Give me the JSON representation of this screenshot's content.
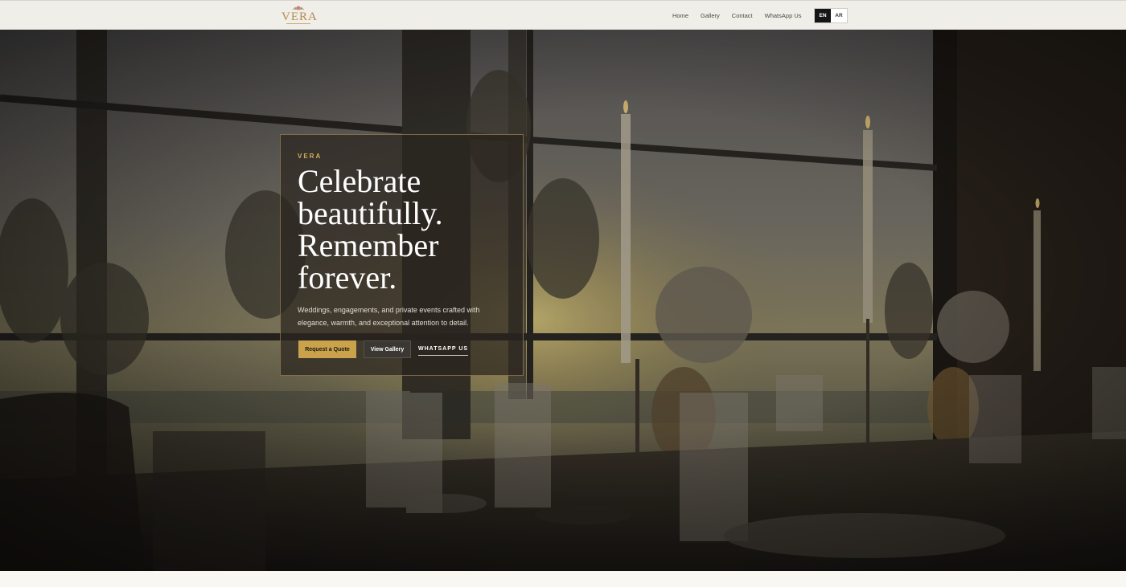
{
  "nav": {
    "logo_text": "VERA",
    "links": [
      "Home",
      "Gallery",
      "Contact",
      "WhatsApp Us"
    ],
    "lang": {
      "active": "EN",
      "inactive": "AR"
    }
  },
  "hero": {
    "eyebrow": "VERA",
    "headline_lines": [
      "Celebrate",
      "beautifully.",
      "Remember",
      "forever."
    ],
    "subtext": "Weddings, engagements, and private events crafted with elegance, warmth, and exceptional attention to detail.",
    "buttons": {
      "quote": "Request a Quote",
      "gallery": "View Gallery",
      "whatsapp": "WHATSAPP US"
    }
  },
  "colors": {
    "accent_gold": "#c9a24b",
    "nav_bg": "#efeee8",
    "dark": "#151515"
  },
  "icons": {
    "logo_mark": "flower-icon"
  }
}
